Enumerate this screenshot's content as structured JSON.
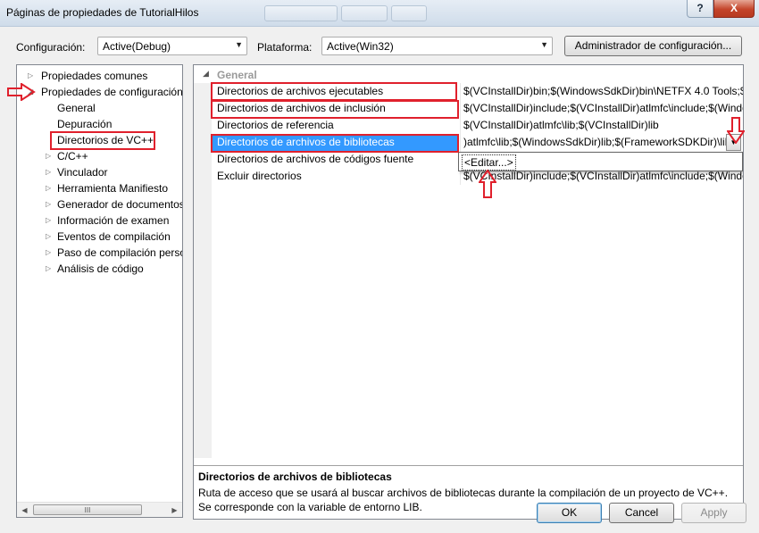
{
  "window": {
    "title": "Páginas de propiedades de TutorialHilos",
    "help_glyph": "?",
    "close_glyph": "X"
  },
  "toolbar": {
    "config_label": "Configuración:",
    "config_value": "Active(Debug)",
    "platform_label": "Plataforma:",
    "platform_value": "Active(Win32)",
    "config_manager_label": "Administrador de configuración..."
  },
  "tree": {
    "items": [
      {
        "label": "Propiedades comunes"
      },
      {
        "label": "Propiedades de configuración"
      },
      {
        "label": "General"
      },
      {
        "label": "Depuración"
      },
      {
        "label": "Directorios de VC++"
      },
      {
        "label": "C/C++"
      },
      {
        "label": "Vinculador"
      },
      {
        "label": "Herramienta Manifiesto"
      },
      {
        "label": "Generador de documentos"
      },
      {
        "label": "Información de examen"
      },
      {
        "label": "Eventos de compilación"
      },
      {
        "label": "Paso de compilación perso"
      },
      {
        "label": "Análisis de código"
      }
    ],
    "scroll_grip": "III"
  },
  "grid": {
    "category": "General",
    "rows": [
      {
        "name": "Directorios de archivos ejecutables",
        "value": "$(VCInstallDir)bin;$(WindowsSdkDir)bin\\NETFX 4.0 Tools;$(W"
      },
      {
        "name": "Directorios de archivos de inclusión",
        "value": "$(VCInstallDir)include;$(VCInstallDir)atlmfc\\include;$(Windo"
      },
      {
        "name": "Directorios de referencia",
        "value": "$(VCInstallDir)atlmfc\\lib;$(VCInstallDir)lib"
      },
      {
        "name": "Directorios de archivos de bibliotecas",
        "value": ")atlmfc\\lib;$(WindowsSdkDir)lib;$(FrameworkSDKDir)\\lib"
      },
      {
        "name": "Directorios de archivos de códigos fuente",
        "value": ""
      },
      {
        "name": "Excluir directorios",
        "value": "$(VCInstallDir)include;$(VCInstallDir)atlmfc\\include;$(Windo"
      }
    ],
    "popup_item": "<Editar...>",
    "description_title": "Directorios de archivos de bibliotecas",
    "description_text": "Ruta de acceso que se usará al buscar archivos de bibliotecas durante la compilación de un proyecto de VC++. Se corresponde con la variable de entorno LIB."
  },
  "footer": {
    "ok_label": "OK",
    "cancel_label": "Cancel",
    "apply_label": "Apply"
  },
  "colors": {
    "selection": "#3399ff",
    "annotation_red": "#e0202c"
  }
}
